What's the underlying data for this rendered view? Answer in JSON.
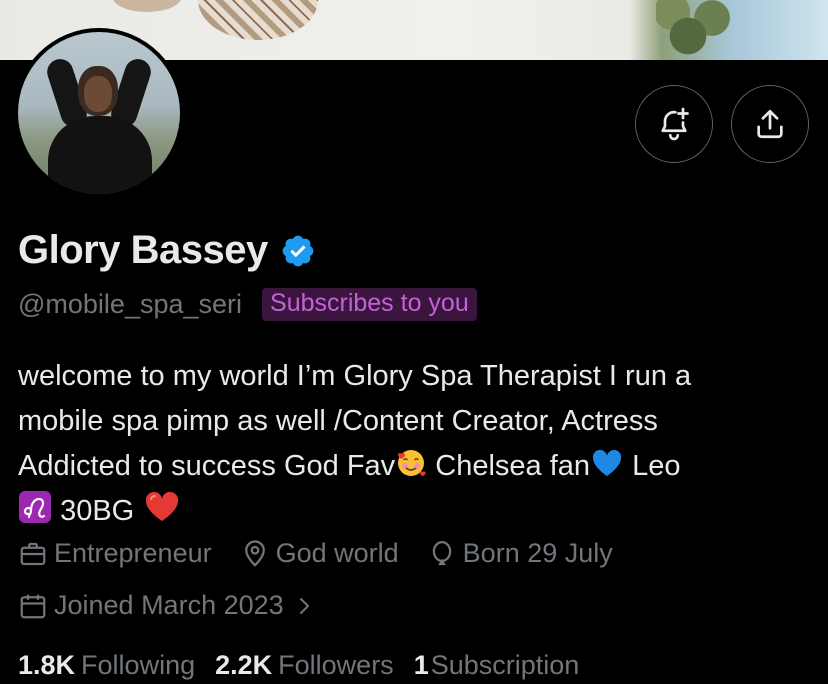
{
  "profile": {
    "name": "Glory Bassey",
    "handle": "@mobile_spa_seri",
    "subscribes_badge": "Subscribes to you",
    "bio": {
      "line1": "welcome to my world I’m Glory Spa Therapist I run a",
      "line2": "mobile spa pimp as well /Content Creator, Actress",
      "line3a": "Addicted to success God Fav",
      "line3b": " Chelsea fan",
      "line3c": " Leo",
      "line4": "30BG"
    },
    "meta": {
      "profession": "Entrepreneur",
      "location": "God world",
      "birthday": "Born 29 July",
      "joined": "Joined March 2023"
    },
    "stats": {
      "following_count": "1.8K",
      "following_label": "Following",
      "followers_count": "2.2K",
      "followers_label": "Followers",
      "subscription_count": "1",
      "subscription_label": "Subscription"
    }
  },
  "icons": {
    "verified": "verified-badge-icon",
    "notify": "bell-plus-icon",
    "share": "share-icon",
    "profession": "briefcase-icon",
    "location": "location-pin-icon",
    "birthday": "balloon-icon",
    "joined": "calendar-icon",
    "chevron": "chevron-right-icon"
  },
  "colors": {
    "background": "#000000",
    "text_primary": "#e7e9ea",
    "text_secondary": "#71767b",
    "verified_blue": "#1d9bf0",
    "badge_bg": "#3a163f",
    "badge_text": "#c561d8"
  }
}
